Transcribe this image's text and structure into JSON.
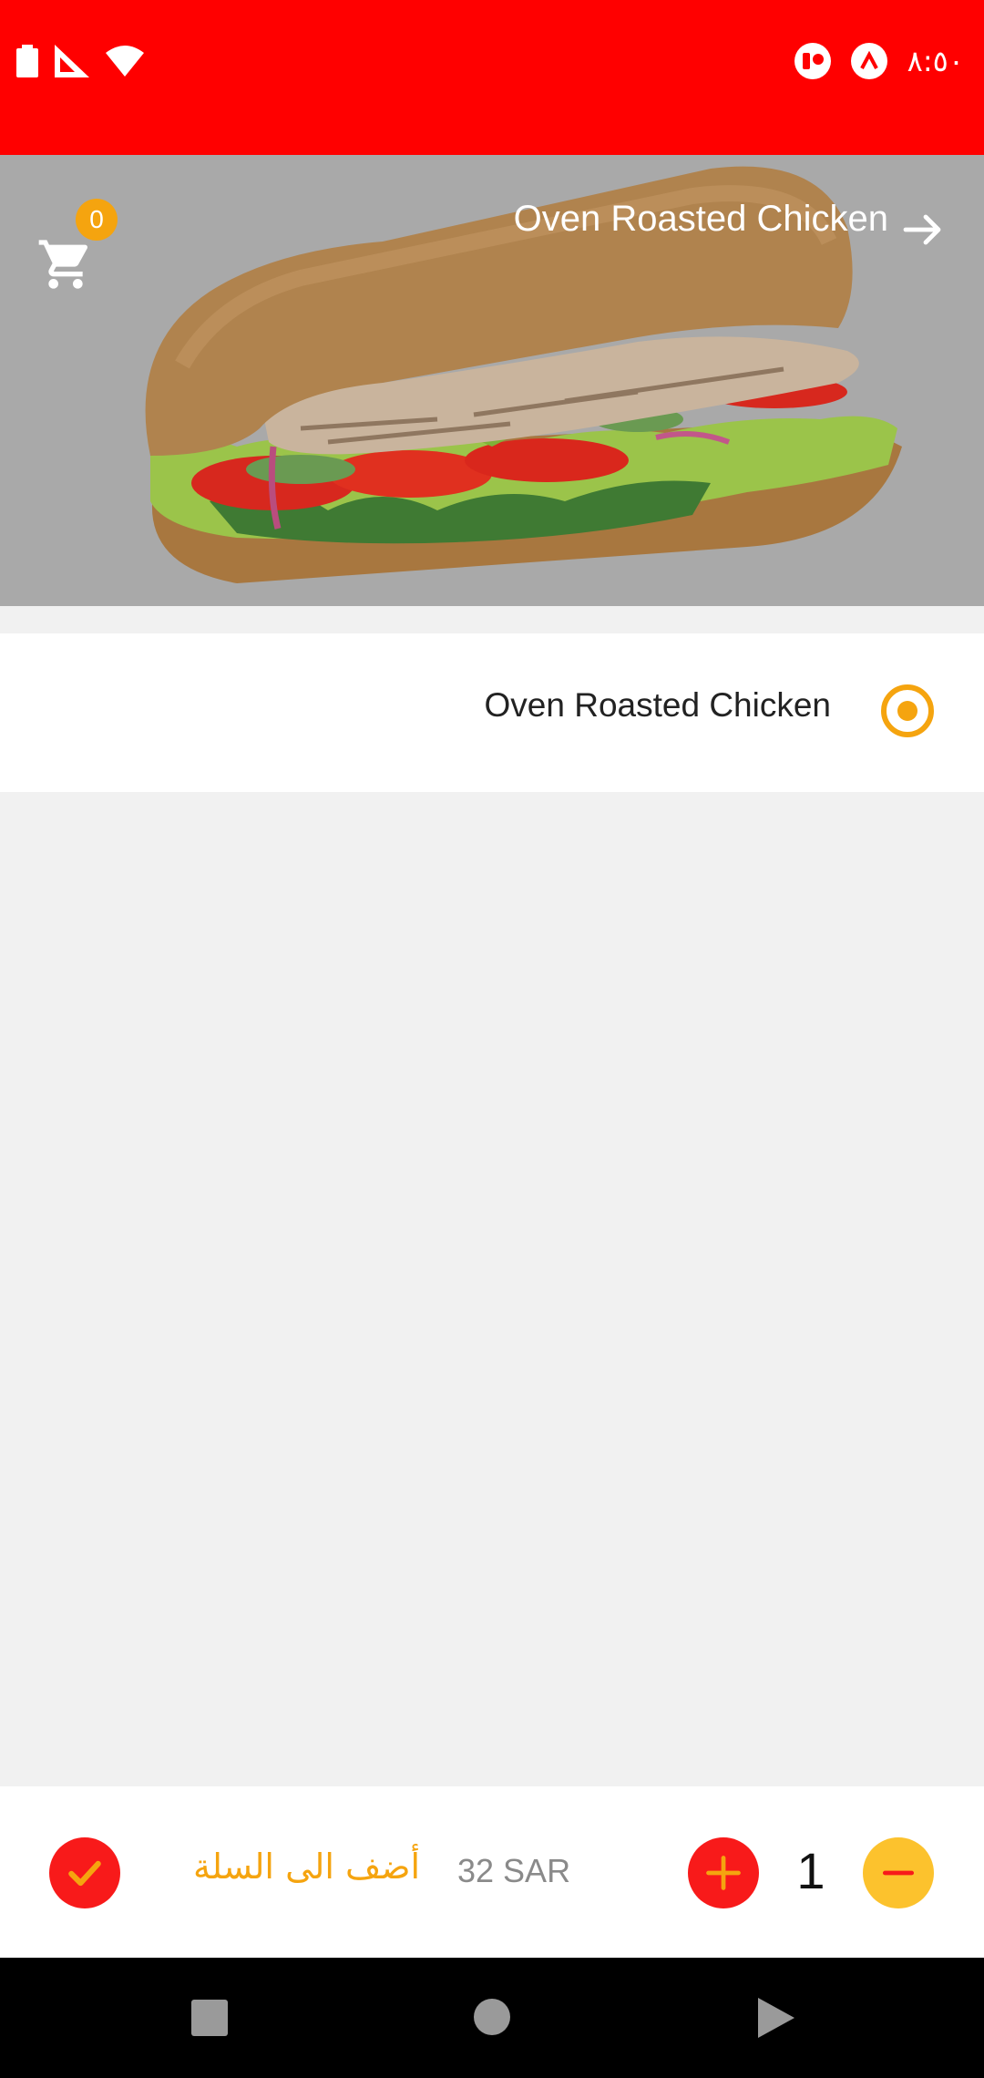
{
  "status_bar": {
    "time": "٨:٥٠",
    "background": "#ff0000",
    "icons": [
      "battery-icon",
      "signal-icon",
      "wifi-icon",
      "notification-icon",
      "app-icon"
    ]
  },
  "hero": {
    "title": "Oven Roasted Chicken",
    "cart_count": "0",
    "image": "sandwich-image"
  },
  "option": {
    "label": "Oven Roasted Chicken",
    "selected": true
  },
  "bottom_bar": {
    "add_to_cart_label": "أضف الى السلة",
    "price": "32 SAR",
    "quantity": "1"
  },
  "colors": {
    "primary_red": "#ff0000",
    "accent_orange": "#f5a40f",
    "minus_yellow": "#fcc22d"
  }
}
